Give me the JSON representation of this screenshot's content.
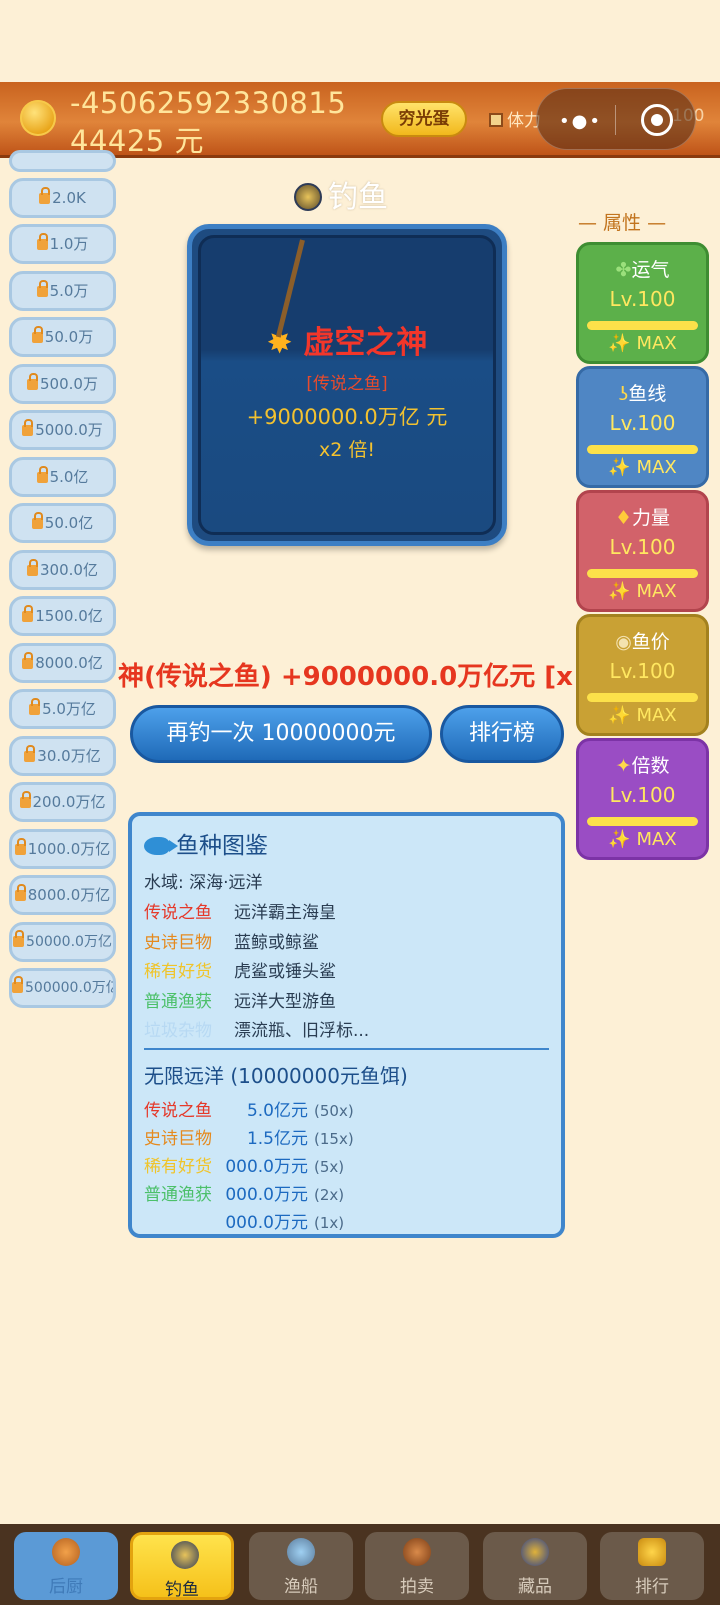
{
  "header": {
    "money": "-4506259233081544425 元",
    "egg_button": "穷光蛋",
    "stamina_label": "体力",
    "stamina_value": "100"
  },
  "thresholds": [
    "2.0K",
    "1.0万",
    "5.0万",
    "50.0万",
    "500.0万",
    "5000.0万",
    "5.0亿",
    "50.0亿",
    "300.0亿",
    "1500.0亿",
    "8000.0亿",
    "5.0万亿",
    "30.0万亿",
    "200.0万亿",
    "1000.0万亿",
    "8000.0万亿",
    "50000.0万亿",
    "500000.0万亿"
  ],
  "fishing": {
    "title": "钓鱼",
    "catch_name": "虚空之神",
    "catch_rarity": "[传说之鱼]",
    "catch_gain": "+9000000.0万亿 元",
    "catch_multiplier": "x2 倍!"
  },
  "attributes": {
    "heading": "— 属性 —",
    "items": [
      {
        "icon": "clover-icon",
        "label": "运气",
        "level": "Lv.100",
        "max": "✨ MAX",
        "color": "#5cb04a",
        "border": "#3e8d32"
      },
      {
        "icon": "hook-icon",
        "label": "鱼线",
        "level": "Lv.100",
        "max": "✨ MAX",
        "color": "#4f86c4",
        "border": "#356aa6"
      },
      {
        "icon": "muscle-icon",
        "label": "力量",
        "level": "Lv.100",
        "max": "✨ MAX",
        "color": "#d2626a",
        "border": "#b2444d"
      },
      {
        "icon": "money-bag-icon",
        "label": "鱼价",
        "level": "Lv.100",
        "max": "✨ MAX",
        "color": "#c9a134",
        "border": "#a3811e"
      },
      {
        "icon": "sparkle-icon",
        "label": "倍数",
        "level": "Lv.100",
        "max": "✨ MAX",
        "color": "#9a4dc4",
        "border": "#7c33a6"
      }
    ]
  },
  "ticker": "神(传说之鱼) +9000000.0万亿元 [x",
  "buttons": {
    "again": "再钓一次 10000000元",
    "rank": "排行榜"
  },
  "encyclopedia": {
    "title": "鱼种图鉴",
    "water": "水域: 深海·远洋",
    "rows": [
      {
        "cat": "传说之鱼",
        "desc": "远洋霸主海皇",
        "color": "#e5392a"
      },
      {
        "cat": "史诗巨物",
        "desc": "蓝鲸或鲸鲨",
        "color": "#e58a1e"
      },
      {
        "cat": "稀有好货",
        "desc": "虎鲨或锤头鲨",
        "color": "#f0c42a"
      },
      {
        "cat": "普通渔获",
        "desc": "远洋大型游鱼",
        "color": "#4cc06a"
      },
      {
        "cat": "垃圾杂物",
        "desc": "漂流瓶、旧浮标...",
        "color": "#b7d9f3"
      }
    ],
    "bait": "无限远洋 (10000000元鱼饵)",
    "prices": [
      {
        "cat": "传说之鱼",
        "price": "5.0亿元",
        "mult": "(50x)",
        "color": "#e5392a"
      },
      {
        "cat": "史诗巨物",
        "price": "1.5亿元",
        "mult": "(15x)",
        "color": "#e58a1e"
      },
      {
        "cat": "稀有好货",
        "price": "000.0万元",
        "mult": "(5x)",
        "color": "#f0c42a"
      },
      {
        "cat": "普通渔获",
        "price": "000.0万元",
        "mult": "(2x)",
        "color": "#4cc06a"
      },
      {
        "cat": "",
        "price": "000.0万元",
        "mult": "(1x)",
        "color": "#b7d9f3"
      }
    ]
  },
  "tabs": [
    {
      "label": "后厨",
      "icon": "chef-icon"
    },
    {
      "label": "钓鱼",
      "icon": "fishing-icon"
    },
    {
      "label": "渔船",
      "icon": "boat-icon"
    },
    {
      "label": "拍卖",
      "icon": "auction-icon"
    },
    {
      "label": "藏品",
      "icon": "collection-icon"
    },
    {
      "label": "排行",
      "icon": "trophy-icon"
    }
  ]
}
